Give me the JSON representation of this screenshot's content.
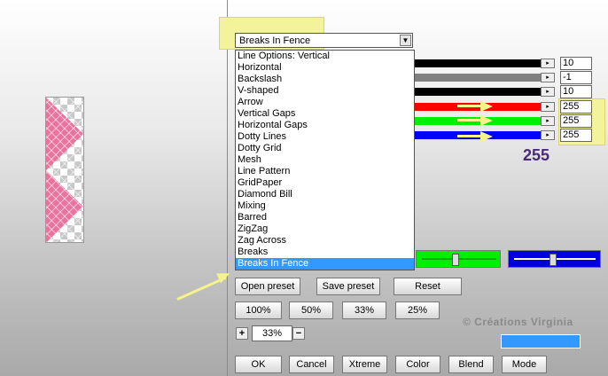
{
  "dropdown": {
    "selected": "Breaks In Fence",
    "arrow_glyph": "▼",
    "options": [
      "Line Options: Vertical",
      "Horizontal",
      "Backslash",
      "V-shaped",
      "Arrow",
      "Vertical Gaps",
      "Horizontal Gaps",
      "Dotty Lines",
      "Dotty Grid",
      "Mesh",
      "Line Pattern",
      "GridPaper",
      "Diamond Bill",
      "Mixing",
      "Barred",
      "ZigZag",
      "Zag Across",
      "Breaks",
      "Breaks In Fence"
    ]
  },
  "sliders": [
    {
      "color": "#000000",
      "value": "10"
    },
    {
      "color": "#808080",
      "value": "-1"
    },
    {
      "color": "#000000",
      "value": "10"
    },
    {
      "color": "#ff0000",
      "value": "255"
    },
    {
      "color": "#00ee00",
      "value": "255"
    },
    {
      "color": "#0000ff",
      "value": "255"
    }
  ],
  "slider_arrow_glyph": "▸",
  "big_value": "255",
  "preset_buttons": {
    "open": "Open preset",
    "save": "Save preset",
    "reset": "Reset"
  },
  "zoom_buttons": [
    "100%",
    "50%",
    "33%",
    "25%"
  ],
  "zoom": {
    "plus": "+",
    "value": "33%",
    "minus": "−"
  },
  "watermark": "© Créations Virginia",
  "bottom_buttons": [
    "OK",
    "Cancel",
    "Xtreme",
    "Color",
    "Blend",
    "Mode"
  ],
  "colors": {
    "highlight": "#f3f39b",
    "selection": "#3399ff",
    "swatch": "#3399ff"
  }
}
